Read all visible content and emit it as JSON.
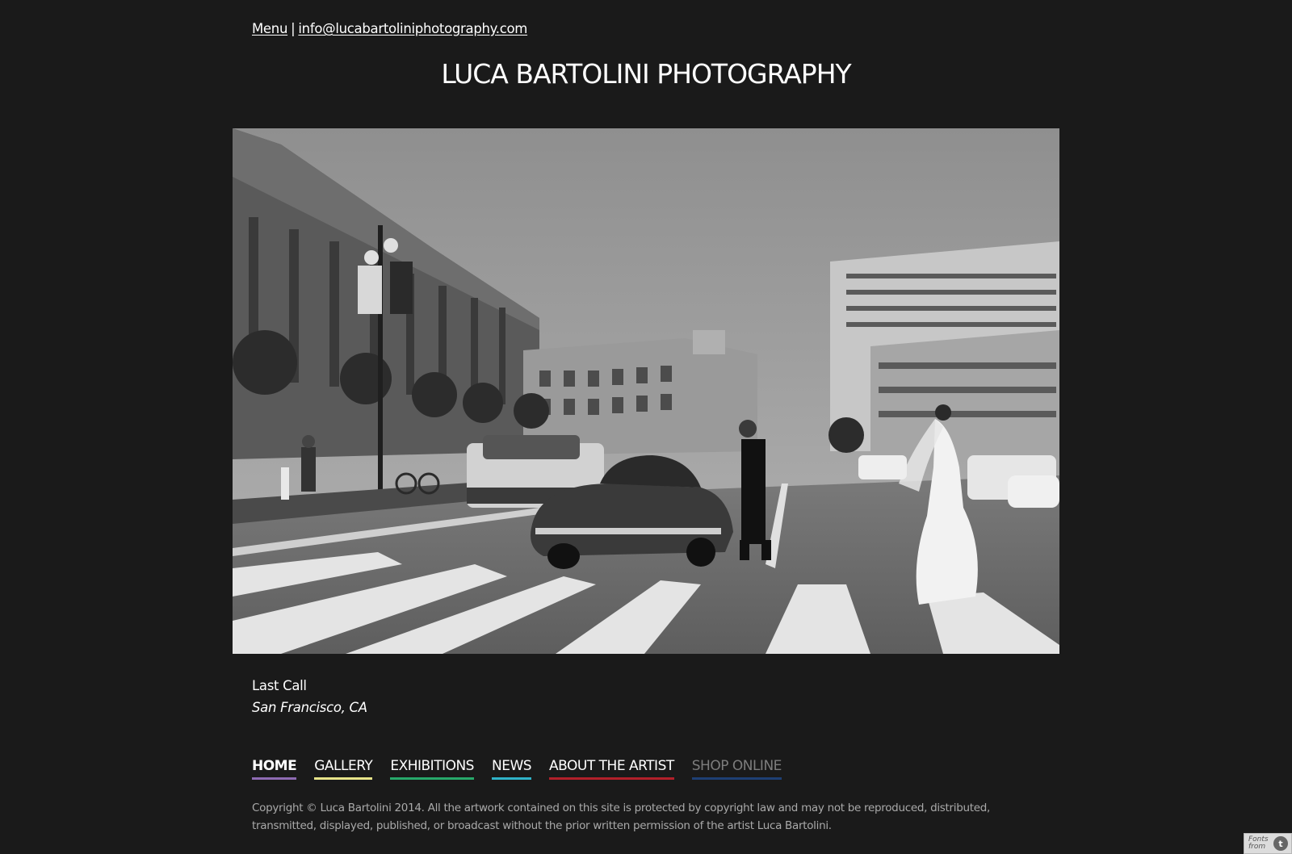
{
  "header": {
    "menu_label": "Menu",
    "separator": "|",
    "email": "info@lucabartoliniphotography.com",
    "site_title": "LUCA BARTOLINI PHOTOGRAPHY"
  },
  "photo": {
    "alt": "Black and white photograph of a bride and groom in a crosswalk beside a vintage car"
  },
  "caption": {
    "title": "Last Call",
    "location": "San Francisco, CA"
  },
  "nav": [
    {
      "label": "HOME",
      "underline_color": "#8e6bb3",
      "active": true
    },
    {
      "label": "GALLERY",
      "underline_color": "#e8e48a",
      "active": false
    },
    {
      "label": "EXHIBITIONS",
      "underline_color": "#27a86a",
      "active": false
    },
    {
      "label": "NEWS",
      "underline_color": "#2fb3c8",
      "active": false
    },
    {
      "label": "ABOUT THE ARTIST",
      "underline_color": "#b3202a",
      "active": false
    },
    {
      "label": "SHOP ONLINE",
      "underline_color": "#1e3f74",
      "active": false,
      "disabled": true
    }
  ],
  "footer": {
    "copyright": "Copyright © Luca Bartolini 2014. All the artwork contained on this site is protected by copyright law and may not be reproduced, distributed, transmitted, displayed, published, or broadcast without the prior written permission of the artist Luca Bartolini."
  },
  "badge": {
    "text": "Fonts from"
  }
}
